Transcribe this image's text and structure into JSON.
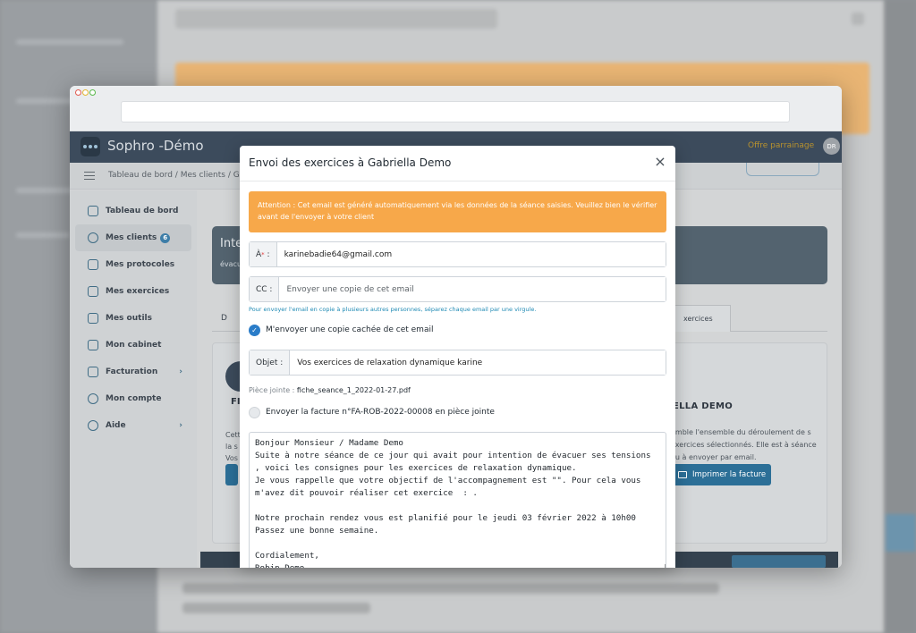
{
  "app": {
    "brand": "Sophro -Démo",
    "offer": "Offre parrainage",
    "avatar_initials": "DR",
    "breadcrumb": "Tableau de bord / Mes clients / Gab"
  },
  "sidebar": {
    "items": [
      {
        "label": "Tableau de bord",
        "icon": "home-icon"
      },
      {
        "label": "Mes clients",
        "icon": "users-icon",
        "badge": "6"
      },
      {
        "label": "Mes protocoles",
        "icon": "protocol-icon"
      },
      {
        "label": "Mes exercices",
        "icon": "cube-icon"
      },
      {
        "label": "Mes outils",
        "icon": "layers-icon"
      },
      {
        "label": "Mon cabinet",
        "icon": "building-icon"
      },
      {
        "label": "Facturation",
        "icon": "invoice-icon"
      },
      {
        "label": "Mon compte",
        "icon": "user-icon"
      },
      {
        "label": "Aide",
        "icon": "help-icon"
      }
    ]
  },
  "background": {
    "info_title": "Inte",
    "info_sub": "évacu",
    "tab_left": "D",
    "tab_right": "xercices",
    "fi_label": "FI",
    "left_text": [
      "Cett",
      "la s",
      "Vos"
    ],
    "demo_label": "ELLA DEMO",
    "right_text": "emble l'ensemble du déroulement de s exercices sélectionnés. Elle est à séance ou à envoyer par email.",
    "print_button": "Imprimer la facture"
  },
  "modal": {
    "title": "Envoi des exercices à Gabriella Demo",
    "alert": "Attention : Cet email est généré automatiquement via les données de la séance saisies. Veuillez bien le vérifier avant de l'envoyer à votre client",
    "to_label": "À",
    "to_value": "karinebadie64@gmail.com",
    "cc_label": "CC :",
    "cc_placeholder": "Envoyer une copie de cet email",
    "cc_help": "Pour envoyer l'email en copie à plusieurs autres personnes, séparez chaque email par une virgule.",
    "bcc_label": "M'envoyer une copie cachée de cet email",
    "bcc_checked": true,
    "subject_label": "Objet :",
    "subject_value": "Vos exercices de relaxation dynamique karine",
    "attachment_label": "Pièce jointe :",
    "attachment_file": "fiche_seance_1_2022-01-27.pdf",
    "invoice_label": "Envoyer la facture n°FA-ROB-2022-00008 en pièce jointe",
    "invoice_checked": false,
    "body": "Bonjour Monsieur / Madame Demo\nSuite à notre séance de ce jour qui avait pour intention de évacuer ses tensions , voici les consignes pour les exercices de relaxation dynamique.\nJe vous rappelle que votre objectif de l'accompagnement est \"\". Pour cela vous m'avez dit pouvoir réaliser cet exercice  : .\n\nNotre prochain rendez vous est planifié pour le jeudi 03 février 2022 à 10h00\nPassez une bonne semaine.\n\nCordialement,\nRobin Demo"
  },
  "colors": {
    "accent": "#2a7cc8",
    "alert": "#f7a84a",
    "topbar": "#3c4b5c"
  }
}
